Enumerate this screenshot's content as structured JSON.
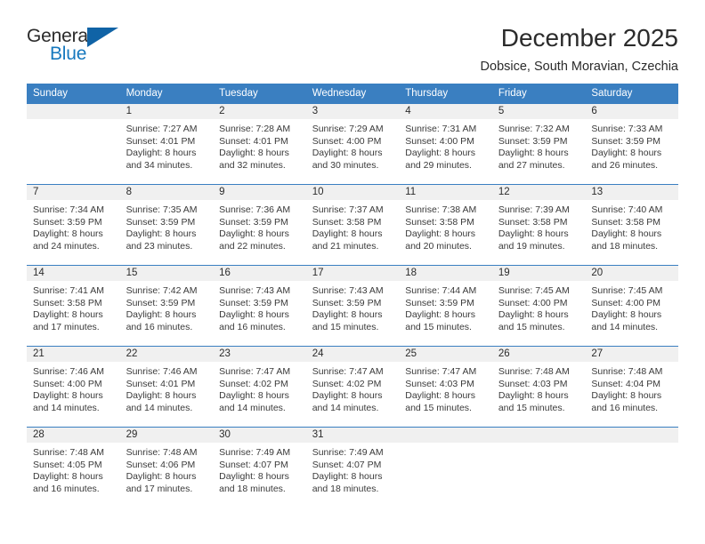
{
  "logo": {
    "word_one": "General",
    "word_two": "Blue",
    "triangle_icon": "blue-triangle-icon"
  },
  "header": {
    "title": "December 2025",
    "subtitle": "Dobsice, South Moravian, Czechia"
  },
  "colors": {
    "header_blue": "#3a7fc1",
    "logo_blue": "#1678be",
    "daynum_band": "#f0f0f0"
  },
  "calendar": {
    "weekday_headers": [
      "Sunday",
      "Monday",
      "Tuesday",
      "Wednesday",
      "Thursday",
      "Friday",
      "Saturday"
    ],
    "weeks": [
      [
        {
          "day": "",
          "lines": []
        },
        {
          "day": "1",
          "lines": [
            "Sunrise: 7:27 AM",
            "Sunset: 4:01 PM",
            "Daylight: 8 hours",
            "and 34 minutes."
          ]
        },
        {
          "day": "2",
          "lines": [
            "Sunrise: 7:28 AM",
            "Sunset: 4:01 PM",
            "Daylight: 8 hours",
            "and 32 minutes."
          ]
        },
        {
          "day": "3",
          "lines": [
            "Sunrise: 7:29 AM",
            "Sunset: 4:00 PM",
            "Daylight: 8 hours",
            "and 30 minutes."
          ]
        },
        {
          "day": "4",
          "lines": [
            "Sunrise: 7:31 AM",
            "Sunset: 4:00 PM",
            "Daylight: 8 hours",
            "and 29 minutes."
          ]
        },
        {
          "day": "5",
          "lines": [
            "Sunrise: 7:32 AM",
            "Sunset: 3:59 PM",
            "Daylight: 8 hours",
            "and 27 minutes."
          ]
        },
        {
          "day": "6",
          "lines": [
            "Sunrise: 7:33 AM",
            "Sunset: 3:59 PM",
            "Daylight: 8 hours",
            "and 26 minutes."
          ]
        }
      ],
      [
        {
          "day": "7",
          "lines": [
            "Sunrise: 7:34 AM",
            "Sunset: 3:59 PM",
            "Daylight: 8 hours",
            "and 24 minutes."
          ]
        },
        {
          "day": "8",
          "lines": [
            "Sunrise: 7:35 AM",
            "Sunset: 3:59 PM",
            "Daylight: 8 hours",
            "and 23 minutes."
          ]
        },
        {
          "day": "9",
          "lines": [
            "Sunrise: 7:36 AM",
            "Sunset: 3:59 PM",
            "Daylight: 8 hours",
            "and 22 minutes."
          ]
        },
        {
          "day": "10",
          "lines": [
            "Sunrise: 7:37 AM",
            "Sunset: 3:58 PM",
            "Daylight: 8 hours",
            "and 21 minutes."
          ]
        },
        {
          "day": "11",
          "lines": [
            "Sunrise: 7:38 AM",
            "Sunset: 3:58 PM",
            "Daylight: 8 hours",
            "and 20 minutes."
          ]
        },
        {
          "day": "12",
          "lines": [
            "Sunrise: 7:39 AM",
            "Sunset: 3:58 PM",
            "Daylight: 8 hours",
            "and 19 minutes."
          ]
        },
        {
          "day": "13",
          "lines": [
            "Sunrise: 7:40 AM",
            "Sunset: 3:58 PM",
            "Daylight: 8 hours",
            "and 18 minutes."
          ]
        }
      ],
      [
        {
          "day": "14",
          "lines": [
            "Sunrise: 7:41 AM",
            "Sunset: 3:58 PM",
            "Daylight: 8 hours",
            "and 17 minutes."
          ]
        },
        {
          "day": "15",
          "lines": [
            "Sunrise: 7:42 AM",
            "Sunset: 3:59 PM",
            "Daylight: 8 hours",
            "and 16 minutes."
          ]
        },
        {
          "day": "16",
          "lines": [
            "Sunrise: 7:43 AM",
            "Sunset: 3:59 PM",
            "Daylight: 8 hours",
            "and 16 minutes."
          ]
        },
        {
          "day": "17",
          "lines": [
            "Sunrise: 7:43 AM",
            "Sunset: 3:59 PM",
            "Daylight: 8 hours",
            "and 15 minutes."
          ]
        },
        {
          "day": "18",
          "lines": [
            "Sunrise: 7:44 AM",
            "Sunset: 3:59 PM",
            "Daylight: 8 hours",
            "and 15 minutes."
          ]
        },
        {
          "day": "19",
          "lines": [
            "Sunrise: 7:45 AM",
            "Sunset: 4:00 PM",
            "Daylight: 8 hours",
            "and 15 minutes."
          ]
        },
        {
          "day": "20",
          "lines": [
            "Sunrise: 7:45 AM",
            "Sunset: 4:00 PM",
            "Daylight: 8 hours",
            "and 14 minutes."
          ]
        }
      ],
      [
        {
          "day": "21",
          "lines": [
            "Sunrise: 7:46 AM",
            "Sunset: 4:00 PM",
            "Daylight: 8 hours",
            "and 14 minutes."
          ]
        },
        {
          "day": "22",
          "lines": [
            "Sunrise: 7:46 AM",
            "Sunset: 4:01 PM",
            "Daylight: 8 hours",
            "and 14 minutes."
          ]
        },
        {
          "day": "23",
          "lines": [
            "Sunrise: 7:47 AM",
            "Sunset: 4:02 PM",
            "Daylight: 8 hours",
            "and 14 minutes."
          ]
        },
        {
          "day": "24",
          "lines": [
            "Sunrise: 7:47 AM",
            "Sunset: 4:02 PM",
            "Daylight: 8 hours",
            "and 14 minutes."
          ]
        },
        {
          "day": "25",
          "lines": [
            "Sunrise: 7:47 AM",
            "Sunset: 4:03 PM",
            "Daylight: 8 hours",
            "and 15 minutes."
          ]
        },
        {
          "day": "26",
          "lines": [
            "Sunrise: 7:48 AM",
            "Sunset: 4:03 PM",
            "Daylight: 8 hours",
            "and 15 minutes."
          ]
        },
        {
          "day": "27",
          "lines": [
            "Sunrise: 7:48 AM",
            "Sunset: 4:04 PM",
            "Daylight: 8 hours",
            "and 16 minutes."
          ]
        }
      ],
      [
        {
          "day": "28",
          "lines": [
            "Sunrise: 7:48 AM",
            "Sunset: 4:05 PM",
            "Daylight: 8 hours",
            "and 16 minutes."
          ]
        },
        {
          "day": "29",
          "lines": [
            "Sunrise: 7:48 AM",
            "Sunset: 4:06 PM",
            "Daylight: 8 hours",
            "and 17 minutes."
          ]
        },
        {
          "day": "30",
          "lines": [
            "Sunrise: 7:49 AM",
            "Sunset: 4:07 PM",
            "Daylight: 8 hours",
            "and 18 minutes."
          ]
        },
        {
          "day": "31",
          "lines": [
            "Sunrise: 7:49 AM",
            "Sunset: 4:07 PM",
            "Daylight: 8 hours",
            "and 18 minutes."
          ]
        },
        {
          "day": "",
          "lines": []
        },
        {
          "day": "",
          "lines": []
        },
        {
          "day": "",
          "lines": []
        }
      ]
    ]
  }
}
